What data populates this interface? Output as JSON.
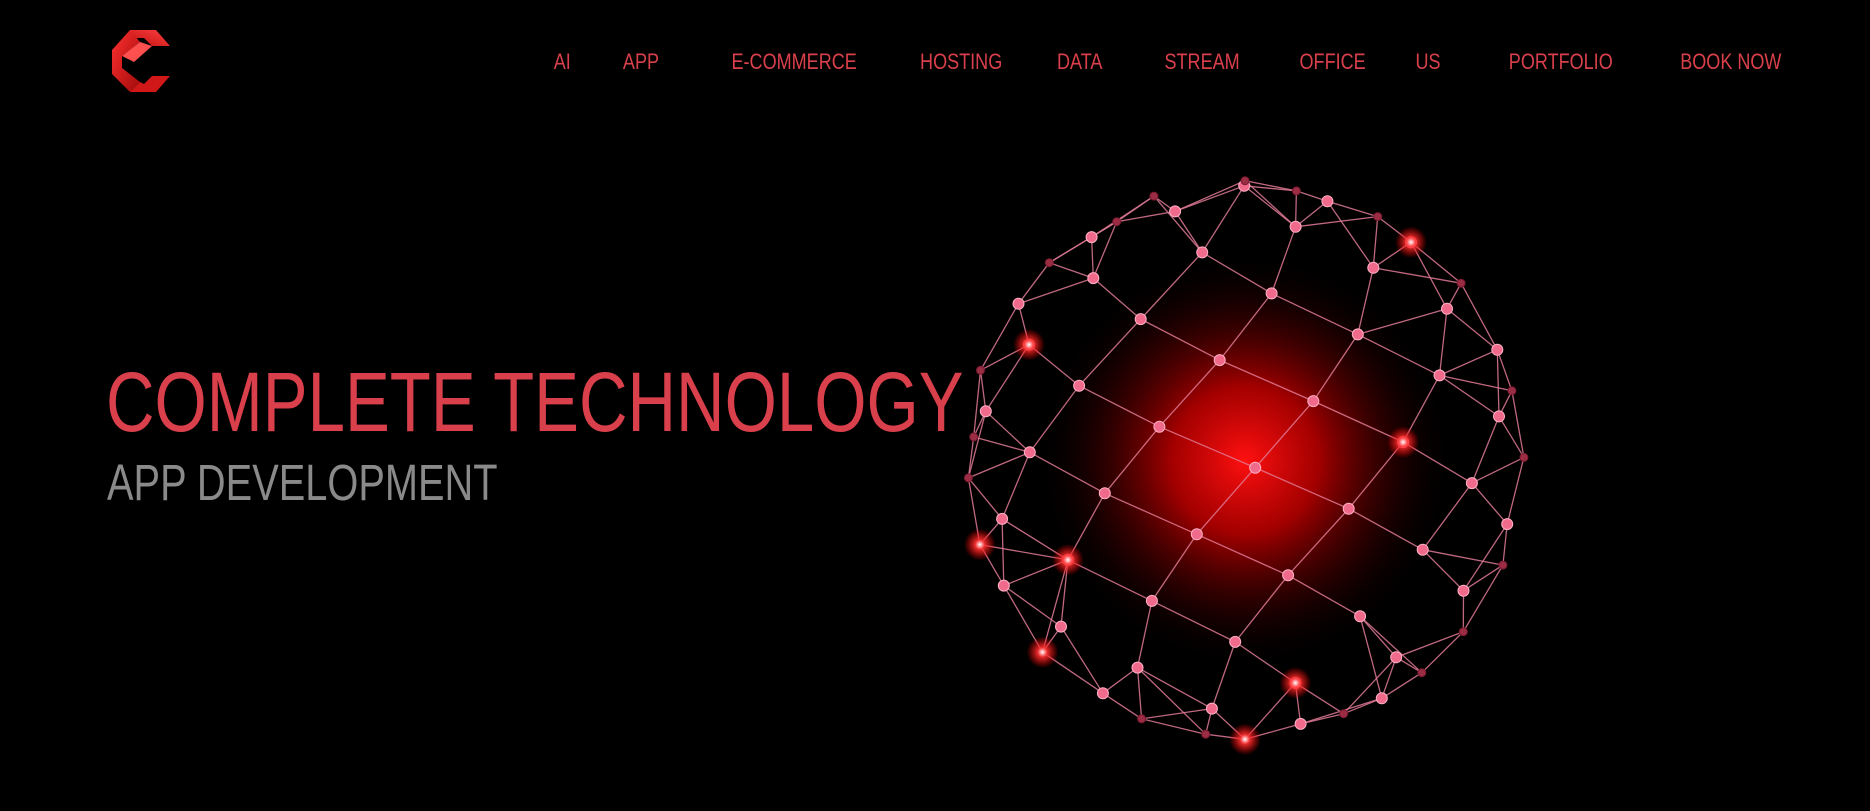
{
  "brand": {
    "logo_icon": "c-ribbon-logo-icon",
    "accent_color": "#d9404b"
  },
  "nav": {
    "items": [
      {
        "label": "AI"
      },
      {
        "label": "APP"
      },
      {
        "label": "E-COMMERCE"
      },
      {
        "label": "HOSTING"
      },
      {
        "label": "DATA"
      },
      {
        "label": "STREAM"
      },
      {
        "label": "OFFICE"
      },
      {
        "label": "US"
      },
      {
        "label": "PORTFOLIO"
      },
      {
        "label": "BOOK NOW"
      }
    ]
  },
  "hero": {
    "title": "COMPLETE TECHNOLOGY",
    "subtitle": "APP DEVELOPMENT",
    "title_color": "#d9404b",
    "subtitle_color": "#8a8a8a",
    "illustration_icon": "network-globe-icon"
  }
}
